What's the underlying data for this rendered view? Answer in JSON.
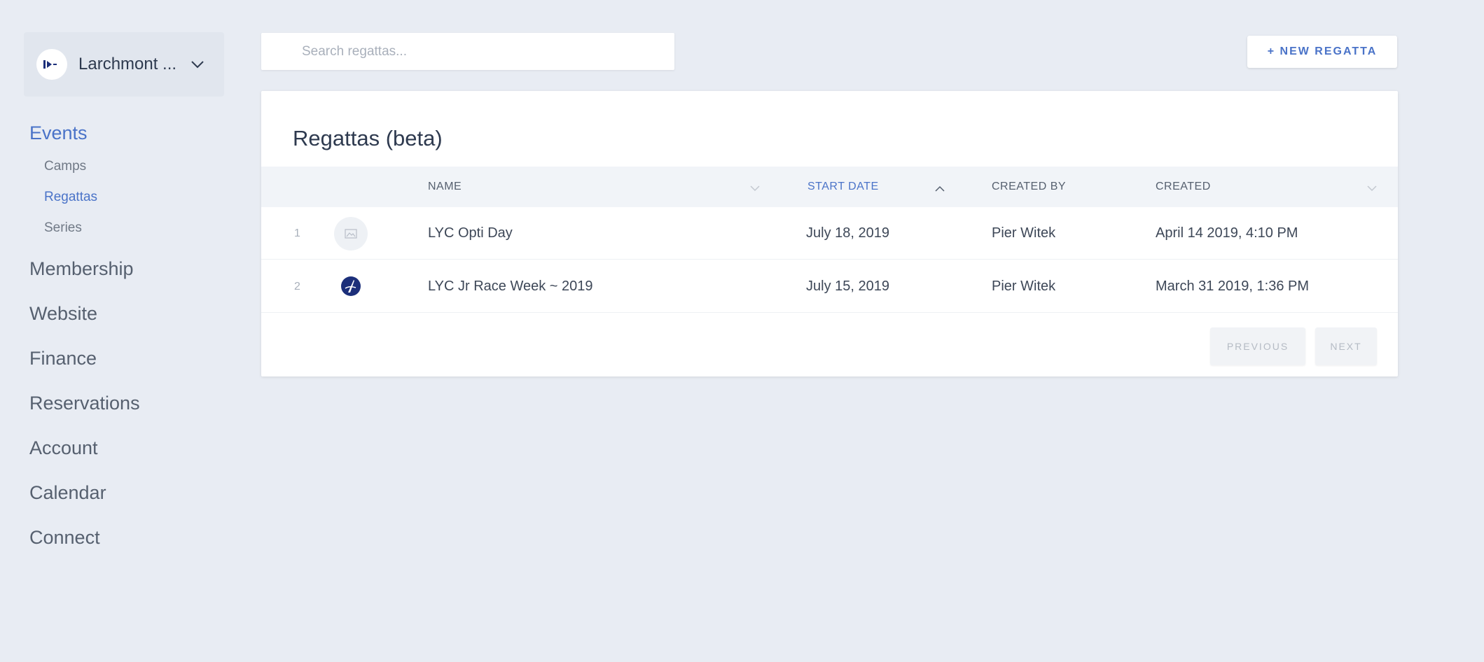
{
  "sidebar": {
    "org_name": "Larchmont ...",
    "nav": [
      {
        "label": "Events"
      },
      {
        "label": "Membership"
      },
      {
        "label": "Website"
      },
      {
        "label": "Finance"
      },
      {
        "label": "Reservations"
      },
      {
        "label": "Account"
      },
      {
        "label": "Calendar"
      },
      {
        "label": "Connect"
      }
    ],
    "sub_nav": [
      {
        "label": "Camps"
      },
      {
        "label": "Regattas"
      },
      {
        "label": "Series"
      }
    ]
  },
  "search": {
    "placeholder": "Search regattas..."
  },
  "new_button": {
    "label": "+ NEW REGATTA"
  },
  "card": {
    "title": "Regattas (beta)"
  },
  "table": {
    "columns": {
      "name": "NAME",
      "start_date": "START DATE",
      "created_by": "CREATED BY",
      "created": "CREATED"
    },
    "rows": [
      {
        "index": "1",
        "name": "LYC Opti Day",
        "start_date": "July 18, 2019",
        "created_by": "Pier Witek",
        "created": "April 14 2019, 4:10 PM"
      },
      {
        "index": "2",
        "name": "LYC Jr Race Week ~ 2019",
        "start_date": "July 15, 2019",
        "created_by": "Pier Witek",
        "created": "March 31 2019, 1:36 PM"
      }
    ]
  },
  "pagination": {
    "previous_label": "PREVIOUS",
    "next_label": "NEXT"
  },
  "colors": {
    "accent": "#4a73c8",
    "background": "#e8ecf3",
    "header_row": "#f1f4f8"
  }
}
